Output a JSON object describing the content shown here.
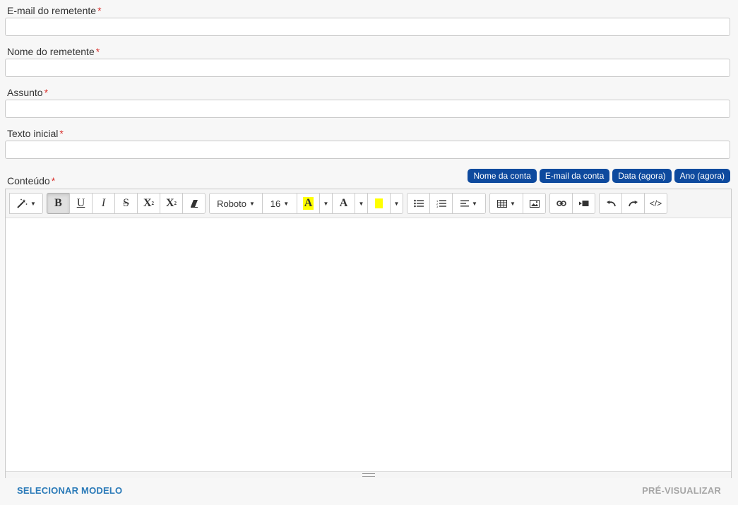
{
  "form": {
    "email_label": "E-mail do remetente",
    "name_label": "Nome do remetente",
    "subject_label": "Assunto",
    "intro_label": "Texto inicial",
    "content_label": "Conteúdo",
    "required_mark": "*",
    "email_value": "",
    "name_value": "",
    "subject_value": "",
    "intro_value": ""
  },
  "variables": [
    {
      "label": "Nome da conta"
    },
    {
      "label": "E-mail da conta"
    },
    {
      "label": "Data (agora)"
    },
    {
      "label": "Ano (agora)"
    }
  ],
  "toolbar": {
    "font_name": "Roboto",
    "font_size": "16",
    "text_color_glyph": "A",
    "fore_color_glyph": "A",
    "bold_glyph": "B",
    "underline_glyph": "U",
    "italic_glyph": "I",
    "strike_glyph": "S",
    "superscript_glyph": "X",
    "subscript_glyph": "X",
    "code_glyph": "</>",
    "highlight_color": "#ffff00"
  },
  "footer": {
    "select_template": "SELECIONAR MODELO",
    "preview": "PRÉ-VISUALIZAR"
  },
  "colors": {
    "accent": "#0e4a9e",
    "link": "#2a7ab8",
    "disabled": "#a6a6a6",
    "required": "#d9302c"
  }
}
